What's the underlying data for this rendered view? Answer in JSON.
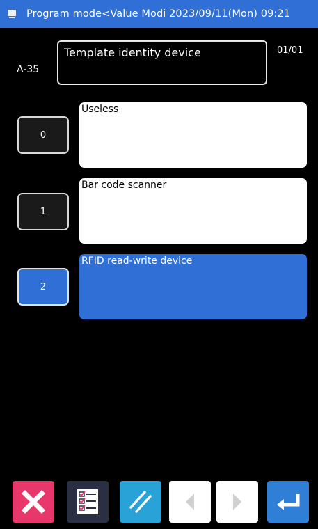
{
  "header": {
    "title": "Program mode<Value Modi  2023/09/11(Mon) 09:21"
  },
  "parameter": {
    "code": "A-35",
    "name": "Template identity device",
    "page": "01/01"
  },
  "options": [
    {
      "number": "0",
      "label": "Useless",
      "selected": false
    },
    {
      "number": "1",
      "label": "Bar code scanner",
      "selected": false
    },
    {
      "number": "2",
      "label": "RFID read-write device",
      "selected": true
    }
  ],
  "colors": {
    "titlebar": "#2f6fd6",
    "selected": "#2f6fd6",
    "close_button": "#e8386b",
    "clear_button": "#29a3d7",
    "enter_button": "#2f7fd6"
  },
  "toolbar": {
    "icons": [
      "close-icon",
      "checklist-icon",
      "clear-icon",
      "previous-icon",
      "next-icon",
      "enter-icon"
    ]
  }
}
